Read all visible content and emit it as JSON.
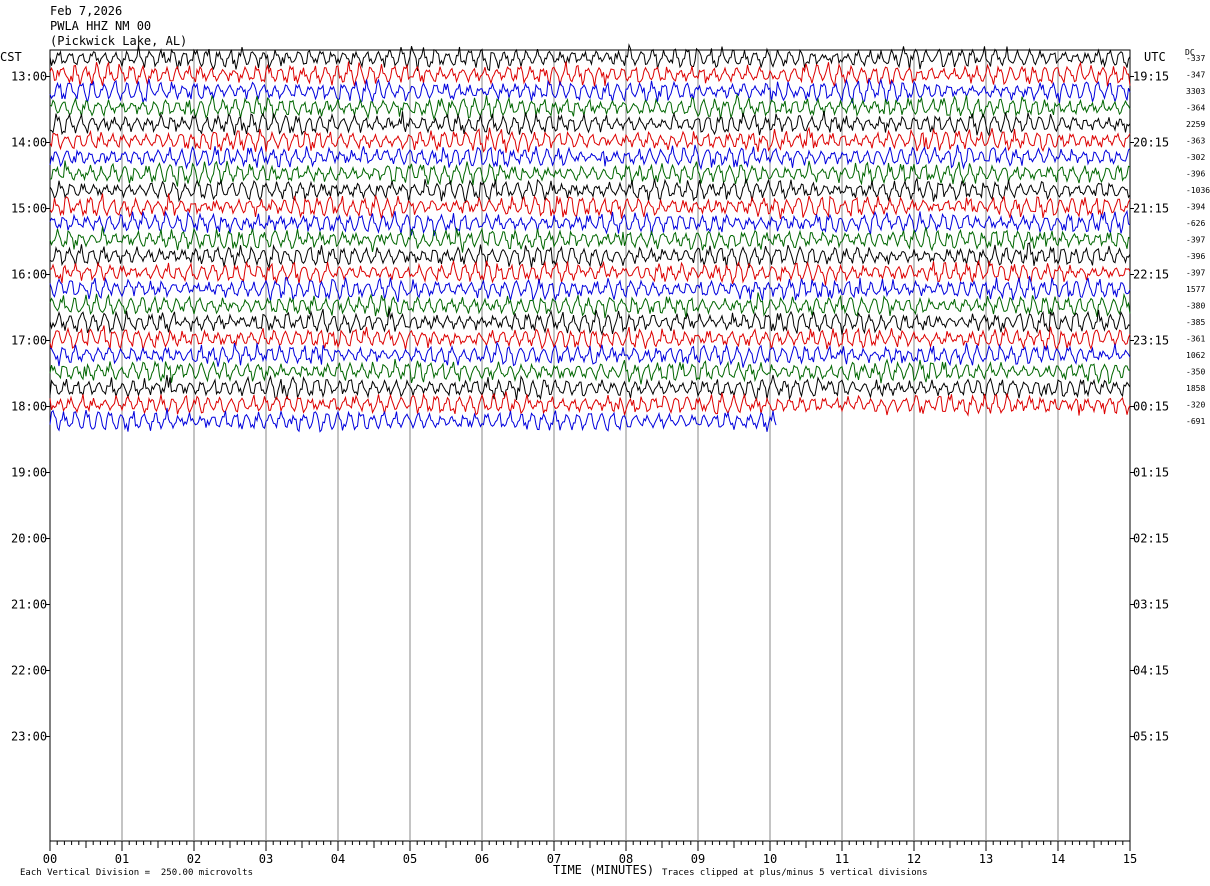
{
  "header": {
    "date": "Feb 7,2026",
    "station": "PWLA HHZ NM 00",
    "location": "(Pickwick Lake, AL)"
  },
  "left_axis_label": "CST",
  "right_axis_label": "UTC",
  "dc_label": "DC",
  "footer": {
    "scale_text": "Each Vertical Division =  250.00 microvolts",
    "axis_title": "TIME (MINUTES)",
    "clip_text": "Traces clipped at plus/minus 5 vertical divisions"
  },
  "chart_data": {
    "type": "line",
    "title": "",
    "xlabel": "TIME (MINUTES)",
    "ylabel": "",
    "xlim": [
      0,
      15
    ],
    "x_ticks": [
      "00",
      "01",
      "02",
      "03",
      "04",
      "05",
      "06",
      "07",
      "08",
      "09",
      "10",
      "11",
      "12",
      "13",
      "14",
      "15"
    ],
    "left_hour_labels": [
      "13:00",
      "14:00",
      "15:00",
      "16:00",
      "17:00",
      "18:00",
      "19:00",
      "20:00",
      "21:00",
      "22:00",
      "23:00"
    ],
    "right_hour_labels": [
      "19:15",
      "20:15",
      "21:15",
      "22:15",
      "23:15",
      "00:15",
      "01:15",
      "02:15",
      "03:15",
      "04:15",
      "05:15"
    ],
    "rows_per_hour": 4,
    "first_row_minute_offset": 45,
    "trace_colors": [
      "#000000",
      "#dd0000",
      "#0000dd",
      "#006600"
    ],
    "dc_offsets": [
      "-337",
      "-347",
      "3303",
      "-364",
      "2259",
      "-363",
      "-302",
      "-396",
      "-1036",
      "-394",
      "-626",
      "-397",
      "-396",
      "-397",
      "1577",
      "-380",
      "-385",
      "-361",
      "1062",
      "-350",
      "1858",
      "-320",
      "-691"
    ],
    "trace_count": 23,
    "last_trace_end_minute": 10.1,
    "grid": true
  }
}
